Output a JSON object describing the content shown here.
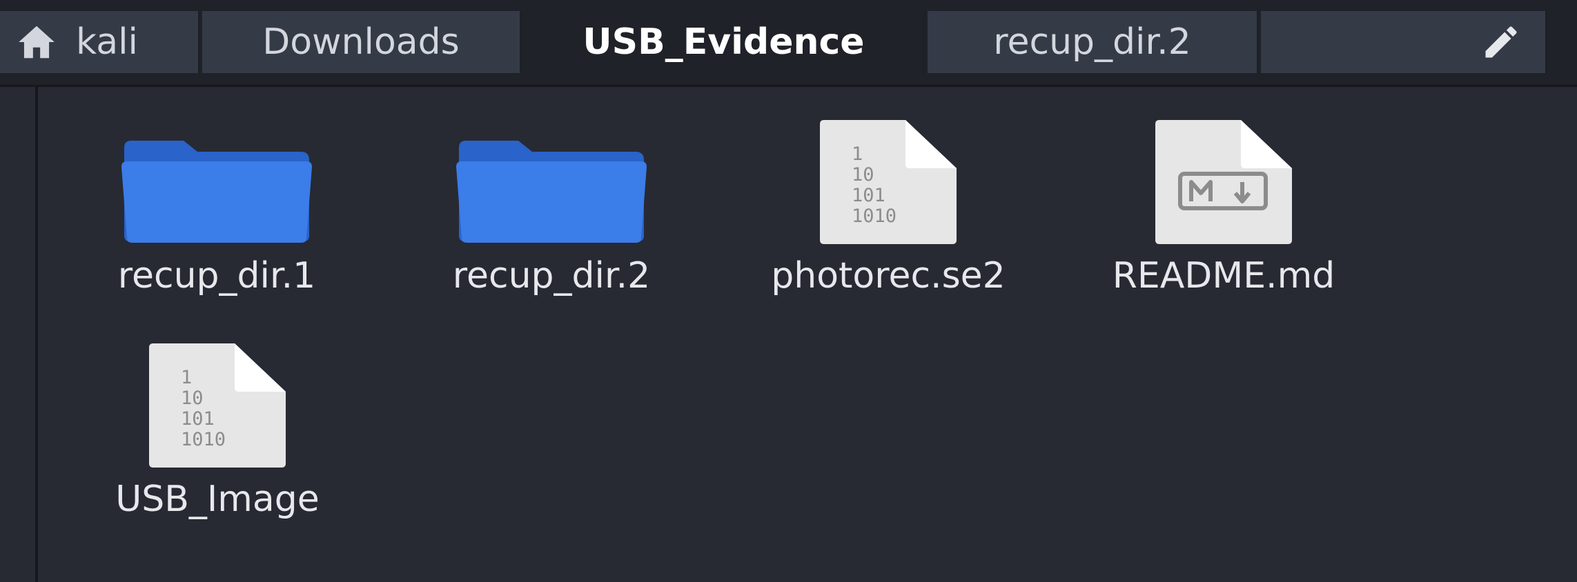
{
  "pathbar": {
    "crumbs": [
      "kali",
      "Downloads",
      "USB_Evidence",
      "recup_dir.2"
    ],
    "current_index": 2
  },
  "files": [
    {
      "name": "recup_dir.1",
      "type": "folder"
    },
    {
      "name": "recup_dir.2",
      "type": "folder"
    },
    {
      "name": "photorec.se2",
      "type": "binary"
    },
    {
      "name": "README.md",
      "type": "markdown"
    },
    {
      "name": "USB_Image",
      "type": "binary"
    }
  ],
  "icons": {
    "home": "home-icon",
    "edit": "pencil-icon",
    "folder": "folder-icon",
    "binary": "binary-file-icon",
    "markdown": "markdown-file-icon"
  },
  "colors": {
    "background": "#272a33",
    "pathbar": "#1f2228",
    "crumb": "#353a47",
    "folder": "#3b7de9",
    "file": "#e6e6e6"
  }
}
